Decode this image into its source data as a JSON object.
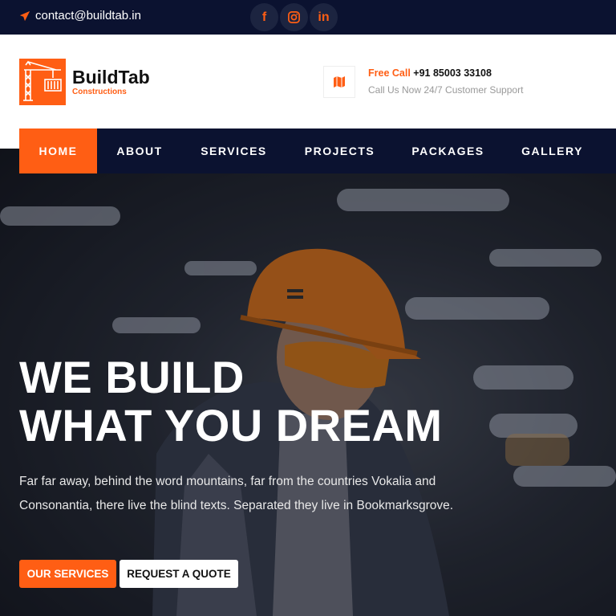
{
  "topbar": {
    "email": "contact@buildtab.in",
    "socials": [
      "facebook-icon",
      "instagram-icon",
      "linkedin-icon"
    ]
  },
  "brand": {
    "name": "BuildTab",
    "tagline": "Constructions"
  },
  "contact": {
    "free_label": "Free Call",
    "phone": "+91 85003 33108",
    "support": "Call Us Now 24/7 Customer Support"
  },
  "nav": {
    "items": [
      "HOME",
      "ABOUT",
      "SERVICES",
      "PROJECTS",
      "PACKAGES",
      "GALLERY"
    ],
    "active": "HOME"
  },
  "hero": {
    "line1": "WE BUILD",
    "line2": "WHAT YOU DREAM",
    "description": "Far far away, behind the word mountains, far from the countries Vokalia and Consonantia, there live the blind texts. Separated they live in Bookmarksgrove.",
    "primary_button": "OUR SERVICES",
    "secondary_button": "REQUEST A QUOTE"
  },
  "colors": {
    "accent": "#ff5e14",
    "navy": "#0b1230"
  }
}
